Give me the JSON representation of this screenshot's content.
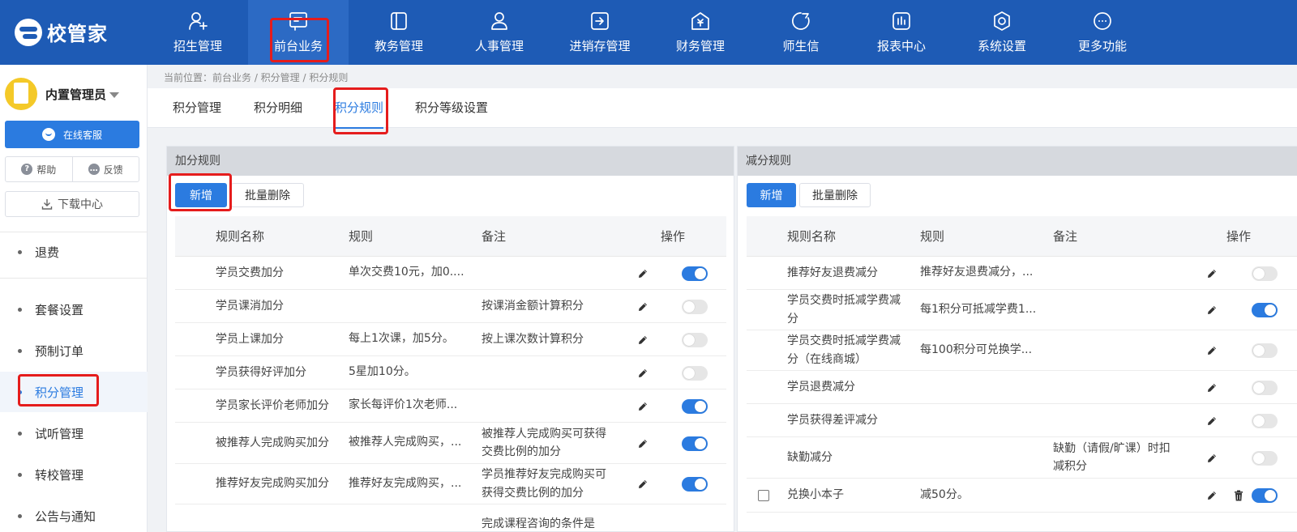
{
  "brand": {
    "name": "校管家"
  },
  "nav": [
    {
      "label": "招生管理",
      "icon": "user-plus-icon"
    },
    {
      "label": "前台业务",
      "icon": "frontdesk-icon",
      "active": true
    },
    {
      "label": "教务管理",
      "icon": "book-icon"
    },
    {
      "label": "人事管理",
      "icon": "person-icon"
    },
    {
      "label": "进销存管理",
      "icon": "inventory-icon"
    },
    {
      "label": "财务管理",
      "icon": "finance-icon"
    },
    {
      "label": "师生信",
      "icon": "message-icon"
    },
    {
      "label": "报表中心",
      "icon": "report-icon"
    },
    {
      "label": "系统设置",
      "icon": "settings-icon"
    },
    {
      "label": "更多功能",
      "icon": "more-icon"
    }
  ],
  "sidebar": {
    "user_name": "内置管理员",
    "service_label": "在线客服",
    "help_label": "帮助",
    "feedback_label": "反馈",
    "download_label": "下载中心",
    "items": [
      {
        "label": "退费"
      },
      {
        "label": "套餐设置"
      },
      {
        "label": "预制订单"
      },
      {
        "label": "积分管理",
        "active": true
      },
      {
        "label": "试听管理"
      },
      {
        "label": "转校管理"
      },
      {
        "label": "公告与通知"
      }
    ]
  },
  "breadcrumb": "当前位置：前台业务 / 积分管理 / 积分规则",
  "tabs": [
    {
      "label": "积分管理"
    },
    {
      "label": "积分明细"
    },
    {
      "label": "积分规则",
      "active": true
    },
    {
      "label": "积分等级设置"
    }
  ],
  "add_panel": {
    "title": "加分规则",
    "add_label": "新增",
    "batch_delete_label": "批量删除",
    "columns": [
      "规则名称",
      "规则",
      "备注",
      "操作"
    ],
    "rows": [
      {
        "name": "学员交费加分",
        "rule": "单次交费10元，加0....",
        "note": "",
        "enabled": true
      },
      {
        "name": "学员课消加分",
        "rule": "",
        "note": "按课消金额计算积分",
        "enabled": false
      },
      {
        "name": "学员上课加分",
        "rule": "每上1次课，加5分。",
        "note": "按上课次数计算积分",
        "enabled": false
      },
      {
        "name": "学员获得好评加分",
        "rule": "5星加10分。",
        "note": "",
        "enabled": false
      },
      {
        "name": "学员家长评价老师加分",
        "rule": "家长每评价1次老师...",
        "note": "",
        "enabled": true
      },
      {
        "name": "被推荐人完成购买加分",
        "rule": "被推荐人完成购买，...",
        "note": "被推荐人完成购买可获得交费比例的加分",
        "enabled": true
      },
      {
        "name": "推荐好友完成购买加分",
        "rule": "推荐好友完成购买，...",
        "note": "学员推荐好友完成购买可获得交费比例的加分",
        "enabled": true
      },
      {
        "name": "",
        "rule": "",
        "note": "完成课程咨询的条件是",
        "enabled": false
      }
    ]
  },
  "sub_panel": {
    "title": "减分规则",
    "add_label": "新增",
    "batch_delete_label": "批量删除",
    "columns": [
      "规则名称",
      "规则",
      "备注",
      "操作"
    ],
    "rows": [
      {
        "name": "推荐好友退费减分",
        "rule": "推荐好友退费减分，...",
        "note": "",
        "enabled": false
      },
      {
        "name": "学员交费时抵减学费减分",
        "rule": "每1积分可抵减学费1...",
        "note": "",
        "enabled": true
      },
      {
        "name": "学员交费时抵减学费减分（在线商城）",
        "rule": "每100积分可兑换学...",
        "note": "",
        "enabled": false
      },
      {
        "name": "学员退费减分",
        "rule": "",
        "note": "",
        "enabled": false
      },
      {
        "name": "学员获得差评减分",
        "rule": "",
        "note": "",
        "enabled": false
      },
      {
        "name": "缺勤减分",
        "rule": "",
        "note": "缺勤（请假/旷课）时扣减积分",
        "enabled": false
      },
      {
        "name": "兑换小本子",
        "rule": "减50分。",
        "note": "",
        "enabled": true,
        "custom": true
      }
    ]
  }
}
